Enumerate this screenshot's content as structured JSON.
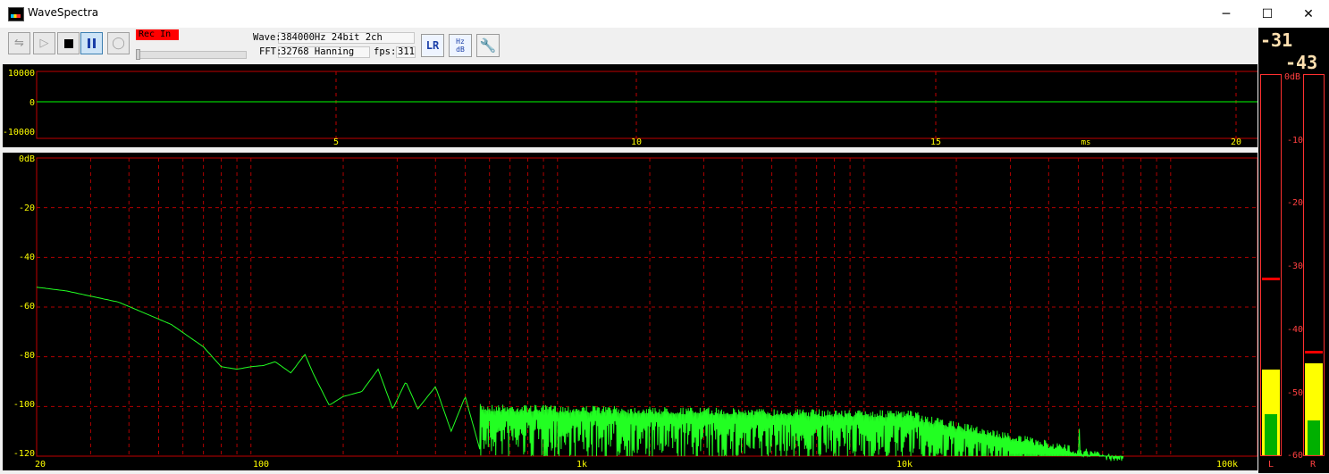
{
  "window": {
    "title": "WaveSpectra",
    "minimize": "─",
    "maximize": "☐",
    "close": "✕"
  },
  "toolbar": {
    "rec_input": "Rec In",
    "wave_label": "Wave:",
    "wave_value": "384000Hz 24bit 2ch",
    "fft_label": "FFT:",
    "fft_value": "32768 Hanning",
    "fps_label": "fps:",
    "fps_value": "311",
    "lr_icon": "LR",
    "hz_db_icon_top": "Hz",
    "hz_db_icon_bottom": "dB"
  },
  "wave_panel": {
    "y_ticks": [
      "10000",
      "0",
      "-10000"
    ],
    "x_ticks": [
      "5",
      "10",
      "15",
      "20"
    ],
    "x_unit": "ms"
  },
  "spectrum_panel": {
    "y_ticks": [
      "0dB",
      "-20",
      "-40",
      "-60",
      "-80",
      "-100",
      "-120"
    ],
    "x_ticks": [
      "20",
      "100",
      "1k",
      "10k",
      "100k"
    ]
  },
  "meter": {
    "left_value": "-31",
    "right_value": "-43",
    "scale": [
      "0dB",
      "-10",
      "-20",
      "-30",
      "-40",
      "-50",
      "-60"
    ],
    "left_label": "L",
    "right_label": "R",
    "left_peak_db": -32,
    "right_peak_db": -43.5,
    "left_yellow_db": -46.5,
    "left_green_db": -53.5,
    "right_yellow_db": -45.5,
    "right_green_db": -54.5
  },
  "colors": {
    "grid": "#c00000",
    "trace": "#00ff00",
    "labels": "#ffff00",
    "meter_yellow": "#ffff00",
    "meter_green": "#00b000",
    "meter_red": "#ff0000"
  }
}
